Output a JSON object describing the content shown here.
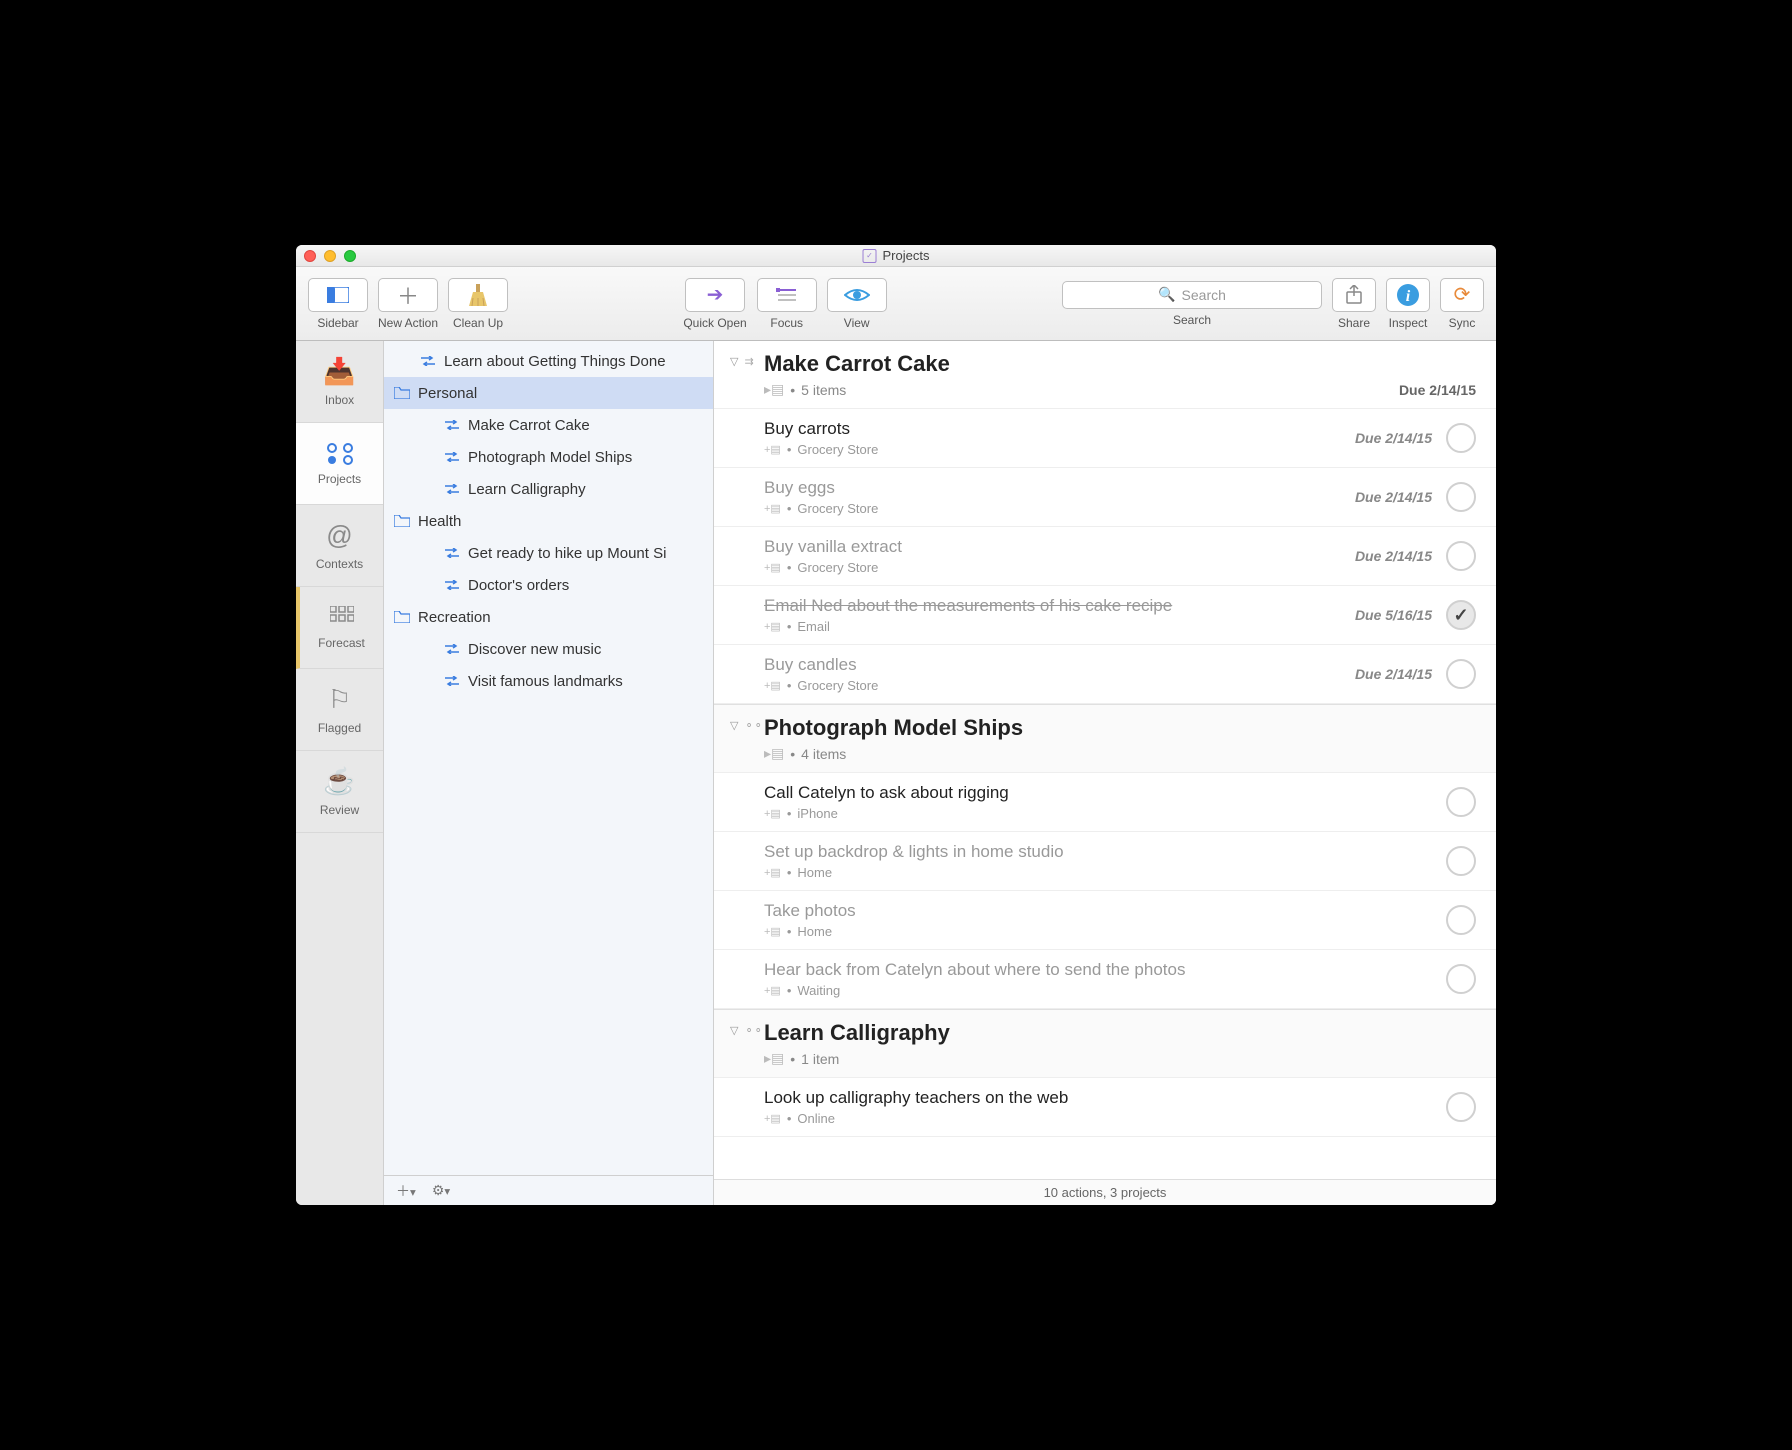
{
  "window": {
    "title": "Projects"
  },
  "toolbar": {
    "sidebar": "Sidebar",
    "new_action": "New Action",
    "clean_up": "Clean Up",
    "quick_open": "Quick Open",
    "focus": "Focus",
    "view": "View",
    "search_placeholder": "Search",
    "search_label": "Search",
    "share": "Share",
    "inspect": "Inspect",
    "sync": "Sync"
  },
  "perspectives": {
    "inbox": "Inbox",
    "projects": "Projects",
    "contexts": "Contexts",
    "forecast": "Forecast",
    "flagged": "Flagged",
    "review": "Review"
  },
  "outline": [
    {
      "label": "Learn about Getting Things Done",
      "type": "seq",
      "indent": 1
    },
    {
      "label": "Personal",
      "type": "folder",
      "indent": 0,
      "selected": true
    },
    {
      "label": "Make Carrot Cake",
      "type": "seq",
      "indent": 2
    },
    {
      "label": "Photograph Model Ships",
      "type": "seq",
      "indent": 2
    },
    {
      "label": "Learn Calligraphy",
      "type": "seq",
      "indent": 2
    },
    {
      "label": "Health",
      "type": "folder",
      "indent": 0
    },
    {
      "label": "Get ready to hike up Mount Si",
      "type": "seq",
      "indent": 2
    },
    {
      "label": "Doctor's orders",
      "type": "seq",
      "indent": 2
    },
    {
      "label": "Recreation",
      "type": "folder",
      "indent": 0
    },
    {
      "label": "Discover new music",
      "type": "seq",
      "indent": 2
    },
    {
      "label": "Visit famous landmarks",
      "type": "seq",
      "indent": 2
    }
  ],
  "projects": [
    {
      "title": "Make Carrot Cake",
      "items_label": "5 items",
      "due": "Due 2/14/15",
      "tasks": [
        {
          "title": "Buy carrots",
          "context": "Grocery Store",
          "due": "Due 2/14/15",
          "completed": false,
          "dim": false
        },
        {
          "title": "Buy eggs",
          "context": "Grocery Store",
          "due": "Due 2/14/15",
          "completed": false,
          "dim": true
        },
        {
          "title": "Buy vanilla extract",
          "context": "Grocery Store",
          "due": "Due 2/14/15",
          "completed": false,
          "dim": true
        },
        {
          "title": "Email Ned about the measurements of his cake recipe",
          "context": "Email",
          "due": "Due 5/16/15",
          "completed": true,
          "dim": true
        },
        {
          "title": "Buy candles",
          "context": "Grocery Store",
          "due": "Due 2/14/15",
          "completed": false,
          "dim": true
        }
      ]
    },
    {
      "title": "Photograph Model Ships",
      "items_label": "4 items",
      "due": "",
      "tasks": [
        {
          "title": "Call Catelyn to ask about rigging",
          "context": "iPhone",
          "due": "",
          "completed": false,
          "dim": false
        },
        {
          "title": "Set up backdrop & lights in home studio",
          "context": "Home",
          "due": "",
          "completed": false,
          "dim": true
        },
        {
          "title": "Take photos",
          "context": "Home",
          "due": "",
          "completed": false,
          "dim": true
        },
        {
          "title": "Hear back from Catelyn about where to send the photos",
          "context": "Waiting",
          "due": "",
          "completed": false,
          "dim": true
        }
      ]
    },
    {
      "title": "Learn Calligraphy",
      "items_label": "1 item",
      "due": "",
      "tasks": [
        {
          "title": "Look up calligraphy teachers on the web",
          "context": "Online",
          "due": "",
          "completed": false,
          "dim": false
        }
      ]
    }
  ],
  "status_bar": "10 actions, 3 projects"
}
